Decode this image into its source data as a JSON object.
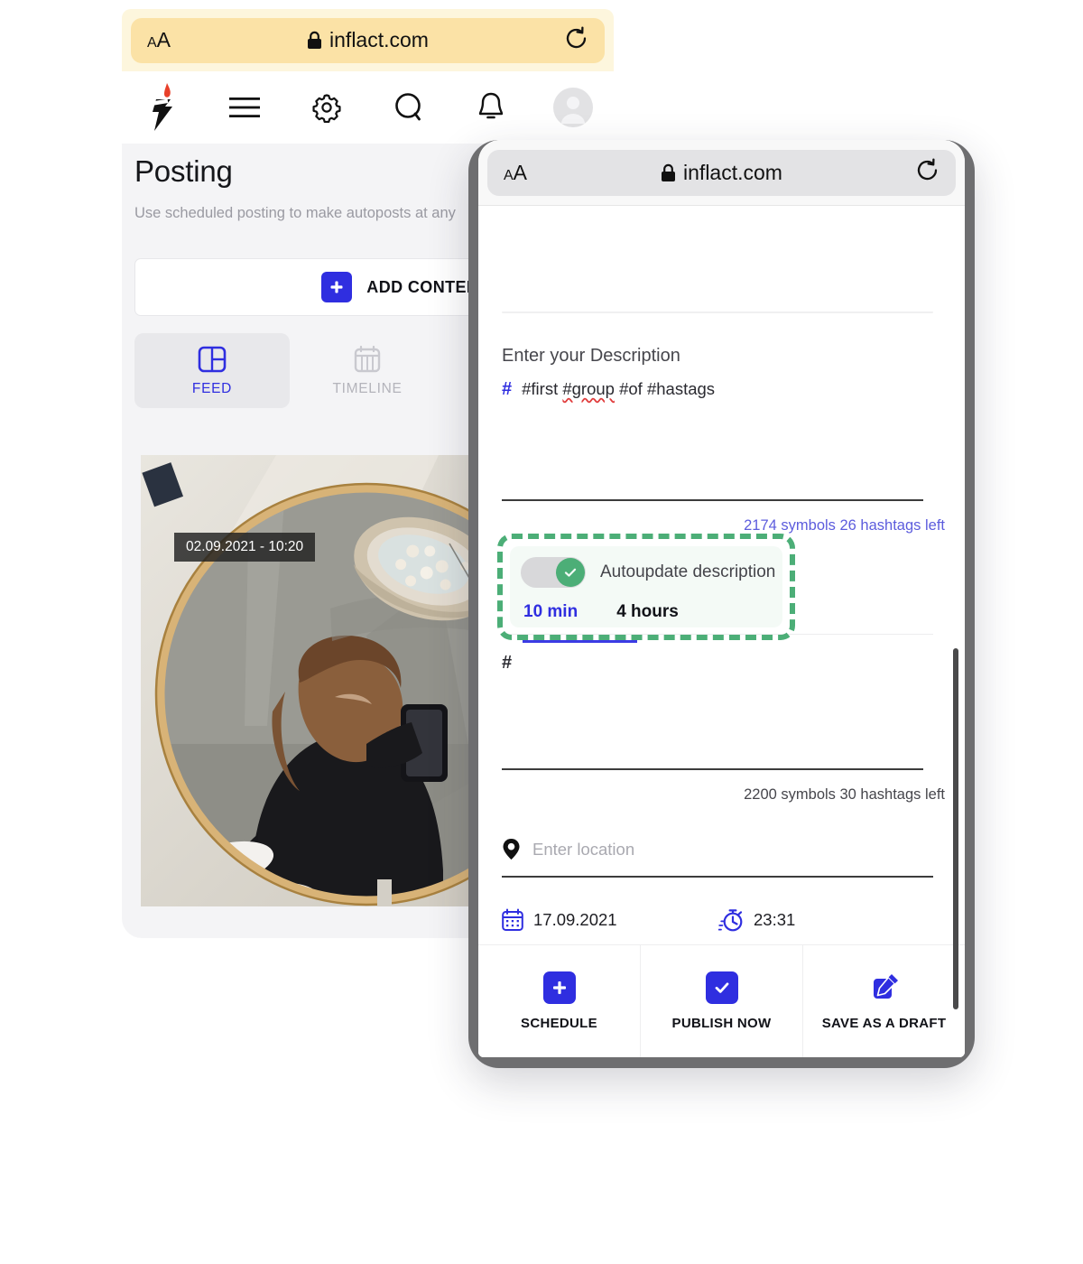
{
  "back_device": {
    "browser": {
      "text_size_small": "A",
      "text_size_large": "A",
      "lock_icon": "lock-icon",
      "url": "inflact.com",
      "reload_icon": "reload-icon"
    },
    "nav": [
      {
        "name": "logo-icon",
        "label": "Inflact"
      },
      {
        "name": "menu-icon",
        "label": "Menu"
      },
      {
        "name": "gear-icon",
        "label": "Settings"
      },
      {
        "name": "search-icon",
        "label": "Search"
      },
      {
        "name": "bell-icon",
        "label": "Notifications"
      },
      {
        "name": "avatar-icon",
        "label": "Account"
      }
    ],
    "page": {
      "title": "Posting",
      "subtitle": "Use scheduled posting to make autoposts at any",
      "add_content_label": "ADD CONTENT",
      "tabs": [
        {
          "label": "FEED",
          "icon": "feed-grid-icon",
          "active": true
        },
        {
          "label": "TIMELINE",
          "icon": "calendar-icon",
          "active": false
        }
      ],
      "photo_timestamp": "02.09.2021 - 10:20"
    }
  },
  "front_device": {
    "browser": {
      "text_size_small": "A",
      "text_size_large": "A",
      "lock_icon": "lock-icon",
      "url": "inflact.com",
      "reload_icon": "reload-icon"
    },
    "form": {
      "description_label": "Enter your Description",
      "hash_icon": "hashtag-icon",
      "description_value_pre": "#first ",
      "description_value_spell": "#group",
      "description_value_post": " #of #hastags",
      "counter_description": "2174 symbols 26 hashtags left",
      "autoupdate": {
        "toggle_state": "on",
        "toggle_icon": "check-icon",
        "label": "Autoupdate description",
        "options": [
          {
            "label": "10 min",
            "selected": true
          },
          {
            "label": "4 hours",
            "selected": false
          }
        ]
      },
      "hashtags_field_icon": "hashtag-icon",
      "hashtags_field_value": "#",
      "counter_hashtags": "2200 symbols 30 hashtags left",
      "location_icon": "pin-icon",
      "location_placeholder": "Enter location",
      "date_icon": "calendar-icon",
      "date_value": "17.09.2021",
      "time_icon": "stopwatch-icon",
      "time_value": "23:31"
    },
    "actions": [
      {
        "label": "SCHEDULE",
        "icon": "plus-icon"
      },
      {
        "label": "PUBLISH NOW",
        "icon": "check-icon"
      },
      {
        "label": "SAVE AS A DRAFT",
        "icon": "edit-pencil-icon"
      }
    ]
  },
  "colors": {
    "accent_blue": "#2F2EE0",
    "highlight_green": "#4CAE77",
    "url_bar_yellow": "#FBE2A6",
    "url_bar_gray": "#E3E3E5",
    "device_frame": "#6E6E70"
  }
}
